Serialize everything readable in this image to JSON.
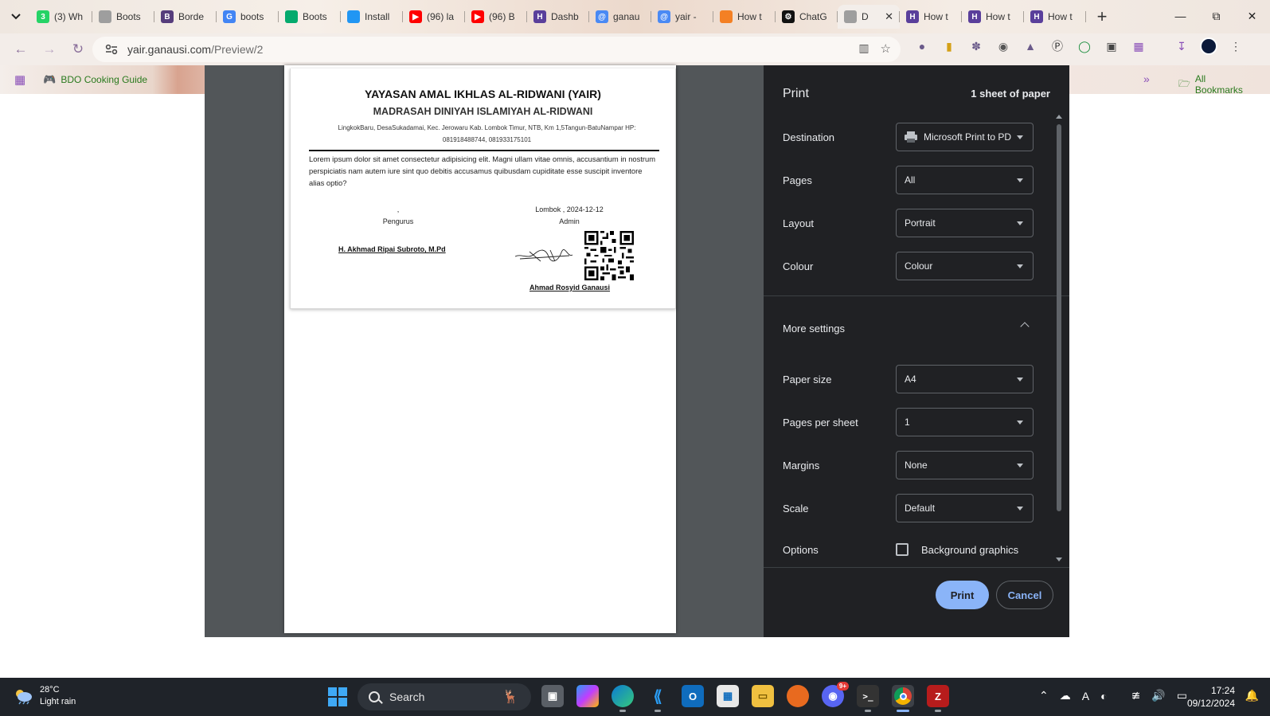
{
  "browser": {
    "tabs": [
      {
        "label": "(3) Wh",
        "icon": "whatsapp-icon",
        "color": "#25d366",
        "glyph": "3"
      },
      {
        "label": "Boots",
        "icon": "globe-icon",
        "color": "#9e9e9e",
        "glyph": ""
      },
      {
        "label": "Borde",
        "icon": "bootstrap-icon",
        "color": "#563d7c",
        "glyph": "B"
      },
      {
        "label": "boots",
        "icon": "google-icon",
        "color": "#4285f4",
        "glyph": "G"
      },
      {
        "label": "Boots",
        "icon": "w3schools-icon",
        "color": "#04aa6d",
        "glyph": ""
      },
      {
        "label": "Install",
        "icon": "feather-icon",
        "color": "#2196f3",
        "glyph": ""
      },
      {
        "label": "(96) la",
        "icon": "youtube-icon",
        "color": "#ff0000",
        "glyph": "▶"
      },
      {
        "label": "(96) B",
        "icon": "youtube-icon",
        "color": "#ff0000",
        "glyph": "▶"
      },
      {
        "label": "Dashb",
        "icon": "heroku-icon",
        "color": "#5a3f9b",
        "glyph": "H"
      },
      {
        "label": "ganau",
        "icon": "site-icon",
        "color": "#4a8af4",
        "glyph": "@"
      },
      {
        "label": "yair -",
        "icon": "site-icon",
        "color": "#4a8af4",
        "glyph": "@"
      },
      {
        "label": "How t",
        "icon": "stackoverflow-icon",
        "color": "#f48024",
        "glyph": ""
      },
      {
        "label": "ChatG",
        "icon": "chatgpt-icon",
        "color": "#111111",
        "glyph": "⚙"
      },
      {
        "label": "D",
        "icon": "globe-icon",
        "color": "#9e9e9e",
        "glyph": ""
      },
      {
        "label": "How t",
        "icon": "heroku-icon",
        "color": "#5a3f9b",
        "glyph": "H"
      },
      {
        "label": "How t",
        "icon": "heroku-icon",
        "color": "#5a3f9b",
        "glyph": "H"
      },
      {
        "label": "How t",
        "icon": "heroku-icon",
        "color": "#5a3f9b",
        "glyph": "H"
      }
    ],
    "url": {
      "host": "yair.ganausi.com",
      "path": "/Preview/2"
    },
    "bookmarks": [
      {
        "label": "BDO Cooking Guide"
      },
      {
        "label": "All Bookmarks"
      }
    ]
  },
  "document": {
    "title": "YAYASAN AMAL IKHLAS AL-RIDWANI (YAIR)",
    "subtitle": "MADRASAH DINIYAH ISLAMIYAH AL-RIDWANI",
    "address": "LingkokBaru, DesaSukadamai, Kec. Jerowaru Kab. Lombok Timur, NTB, Km 1,5Tangun-BatuNampar HP: 081918488744, 081933175101",
    "body": "Lorem ipsum dolor sit amet consectetur adipisicing elit. Magni ullam vitae omnis, accusantium in nostrum perspiciatis nam autem iure sint quo debitis accusamus quibusdam cupiditate esse suscipit inventore alias optio?",
    "left_place": ",",
    "left_role": "Pengurus",
    "left_name": "H. Akhmad Ripai Subroto, M.Pd",
    "right_place_date": "Lombok , 2024-12-12",
    "right_role": "Admin",
    "right_name": "Ahmad Rosyid Ganausi"
  },
  "print": {
    "header": "Print",
    "sheets": "1 sheet of paper",
    "destination": {
      "label": "Destination",
      "value": "Microsoft Print to PDF"
    },
    "pages": {
      "label": "Pages",
      "value": "All"
    },
    "layout": {
      "label": "Layout",
      "value": "Portrait"
    },
    "colour": {
      "label": "Colour",
      "value": "Colour"
    },
    "more_settings": "More settings",
    "paper_size": {
      "label": "Paper size",
      "value": "A4"
    },
    "pages_per_sheet": {
      "label": "Pages per sheet",
      "value": "1"
    },
    "margins": {
      "label": "Margins",
      "value": "None"
    },
    "scale": {
      "label": "Scale",
      "value": "Default"
    },
    "options": {
      "label": "Options",
      "checkbox": "Background graphics",
      "checked": false
    },
    "print_button": "Print",
    "cancel_button": "Cancel"
  },
  "taskbar": {
    "weather_temp": "28°C",
    "weather_desc": "Light rain",
    "search_label": "Search",
    "time": "17:24",
    "date": "09/12/2024",
    "discord_badge": "9+"
  }
}
